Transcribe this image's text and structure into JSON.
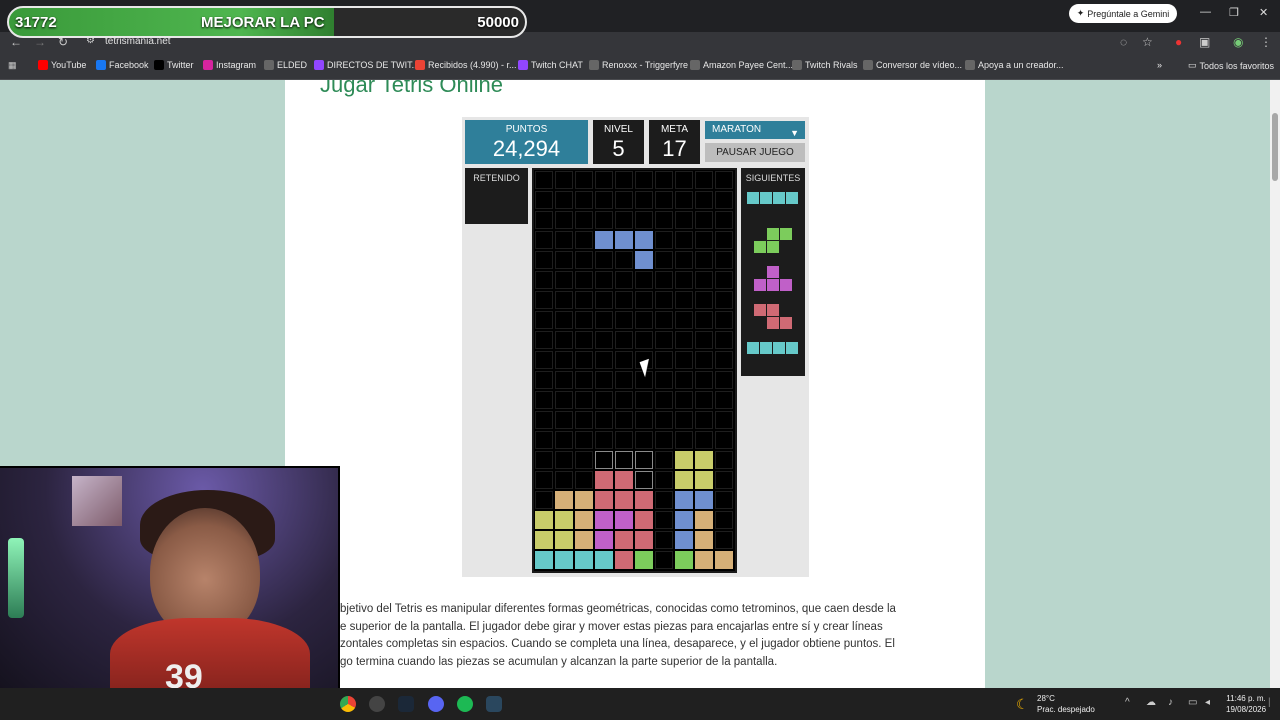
{
  "overlay": {
    "goal_current": "31772",
    "goal_title": "MEJORAR LA PC",
    "goal_target": "50000"
  },
  "browser": {
    "new_tab": "+",
    "gemini_label": "Pregúntale a Gemini",
    "url": "tetrismania.net",
    "bookmarks": [
      {
        "label": "YouTube",
        "color": "#ff0000"
      },
      {
        "label": "Facebook",
        "color": "#1877f2"
      },
      {
        "label": "Twitter",
        "color": "#000000"
      },
      {
        "label": "Instagram",
        "color": "#d6249f"
      },
      {
        "label": "ELDED",
        "color": "#666666"
      },
      {
        "label": "DIRECTOS DE TWIT...",
        "color": "#9146ff"
      },
      {
        "label": "Recibidos (4.990) - r...",
        "color": "#ea4335"
      },
      {
        "label": "Twitch CHAT",
        "color": "#9146ff"
      },
      {
        "label": "Renoxxx - Triggerfyre",
        "color": "#666666"
      },
      {
        "label": "Amazon Payee Cent...",
        "color": "#666666"
      },
      {
        "label": "Twitch Rivals",
        "color": "#666666"
      },
      {
        "label": "Conversor de vídeo...",
        "color": "#666666"
      },
      {
        "label": "Apoya a un creador...",
        "color": "#666666"
      }
    ],
    "all_bookmarks": "Todos los favoritos"
  },
  "page": {
    "title": "Jugar Tetris Online",
    "paragraph_lines": [
      "bjetivo del Tetris es manipular diferentes formas geométricas, conocidas como tetrominos, que caen desde la",
      "e superior de la pantalla. El jugador debe girar y mover estas piezas para encajarlas entre sí y crear líneas",
      "zontales completas sin espacios. Cuando se completa una línea, desaparece, y el jugador obtiene puntos. El",
      "go termina cuando las piezas se acumulan y alcanzan la parte superior de la pantalla."
    ]
  },
  "game": {
    "points_label": "PUNTOS",
    "points_value": "24,294",
    "level_label": "NIVEL",
    "level_value": "5",
    "goal_label": "META",
    "goal_value": "17",
    "mode_label": "MARATON",
    "pause_label": "PAUSAR JUEGO",
    "held_label": "RETENIDO",
    "next_label": "SIGUIENTES",
    "colors": {
      "I": "#66c9c9",
      "J": "#6f8fcf",
      "S": "#7ccc5c",
      "T": "#c060c8",
      "Z": "#cf6a74",
      "O": "#c8cc6a",
      "L": "#d6b078",
      "ghost": "#000000"
    },
    "board_rows": [
      "..........",
      "..........",
      "..........",
      "...JJJ....",
      ".....J....",
      "..........",
      "..........",
      "..........",
      "..........",
      "..........",
      "..........",
      "..........",
      "..........",
      "..........",
      "...ggg.OO.",
      "...ZZg.OO.",
      ".LLZZZ.JJ.",
      "OOLTTZ.JL.",
      "OOLTZZ.JL.",
      "IIIIZS.SLL"
    ],
    "next_pieces": [
      [
        "IIII"
      ],
      [
        ".SS",
        "SS."
      ],
      [
        ".T.",
        "TTT"
      ],
      [
        "ZZ.",
        ".ZZ"
      ],
      [
        "IIII"
      ]
    ]
  },
  "taskbar": {
    "temperature": "28°C",
    "weather": "Prac. despejado",
    "time": "11:46 p. m.",
    "date": "19/08/2026"
  }
}
